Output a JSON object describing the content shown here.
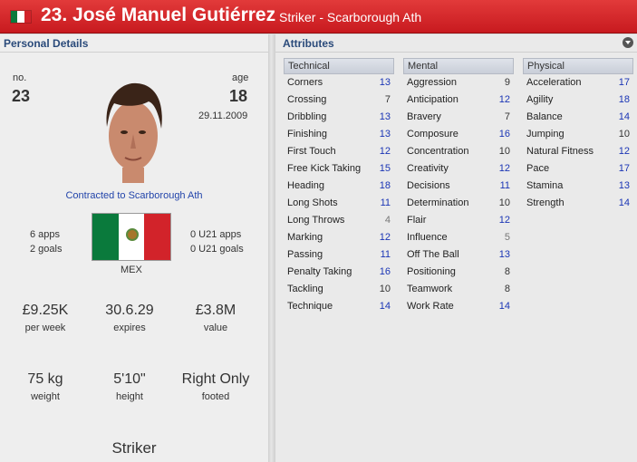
{
  "header": {
    "title": "23. José Manuel Gutiérrez",
    "subtitle": "Striker - Scarborough Ath"
  },
  "personal": {
    "section_title": "Personal Details",
    "number_label": "no.",
    "number": "23",
    "age_label": "age",
    "age": "18",
    "dob": "29.11.2009",
    "contract": "Contracted to Scarborough Ath",
    "apps": "6 apps",
    "goals": "2 goals",
    "u21_apps": "0 U21 apps",
    "u21_goals": "0 U21 goals",
    "nation": "MEX",
    "wage": "£9.25K",
    "wage_label": "per week",
    "expires": "30.6.29",
    "expires_label": "expires",
    "value": "£3.8M",
    "value_label": "value",
    "weight": "75 kg",
    "weight_label": "weight",
    "height": "5'10\"",
    "height_label": "height",
    "foot": "Right Only",
    "foot_label": "footed",
    "position": "Striker"
  },
  "attributes": {
    "section_title": "Attributes",
    "technical_title": "Technical",
    "mental_title": "Mental",
    "physical_title": "Physical",
    "technical": [
      {
        "name": "Corners",
        "value": "13"
      },
      {
        "name": "Crossing",
        "value": "7"
      },
      {
        "name": "Dribbling",
        "value": "13"
      },
      {
        "name": "Finishing",
        "value": "13"
      },
      {
        "name": "First Touch",
        "value": "12"
      },
      {
        "name": "Free Kick Taking",
        "value": "15"
      },
      {
        "name": "Heading",
        "value": "18"
      },
      {
        "name": "Long Shots",
        "value": "11"
      },
      {
        "name": "Long Throws",
        "value": "4"
      },
      {
        "name": "Marking",
        "value": "12"
      },
      {
        "name": "Passing",
        "value": "11"
      },
      {
        "name": "Penalty Taking",
        "value": "16"
      },
      {
        "name": "Tackling",
        "value": "10"
      },
      {
        "name": "Technique",
        "value": "14"
      }
    ],
    "mental": [
      {
        "name": "Aggression",
        "value": "9"
      },
      {
        "name": "Anticipation",
        "value": "12"
      },
      {
        "name": "Bravery",
        "value": "7"
      },
      {
        "name": "Composure",
        "value": "16"
      },
      {
        "name": "Concentration",
        "value": "10"
      },
      {
        "name": "Creativity",
        "value": "12"
      },
      {
        "name": "Decisions",
        "value": "11"
      },
      {
        "name": "Determination",
        "value": "10"
      },
      {
        "name": "Flair",
        "value": "12"
      },
      {
        "name": "Influence",
        "value": "5"
      },
      {
        "name": "Off The Ball",
        "value": "13"
      },
      {
        "name": "Positioning",
        "value": "8"
      },
      {
        "name": "Teamwork",
        "value": "8"
      },
      {
        "name": "Work Rate",
        "value": "14"
      }
    ],
    "physical": [
      {
        "name": "Acceleration",
        "value": "17"
      },
      {
        "name": "Agility",
        "value": "18"
      },
      {
        "name": "Balance",
        "value": "14"
      },
      {
        "name": "Jumping",
        "value": "10"
      },
      {
        "name": "Natural Fitness",
        "value": "12"
      },
      {
        "name": "Pace",
        "value": "17"
      },
      {
        "name": "Stamina",
        "value": "13"
      },
      {
        "name": "Strength",
        "value": "14"
      }
    ]
  }
}
